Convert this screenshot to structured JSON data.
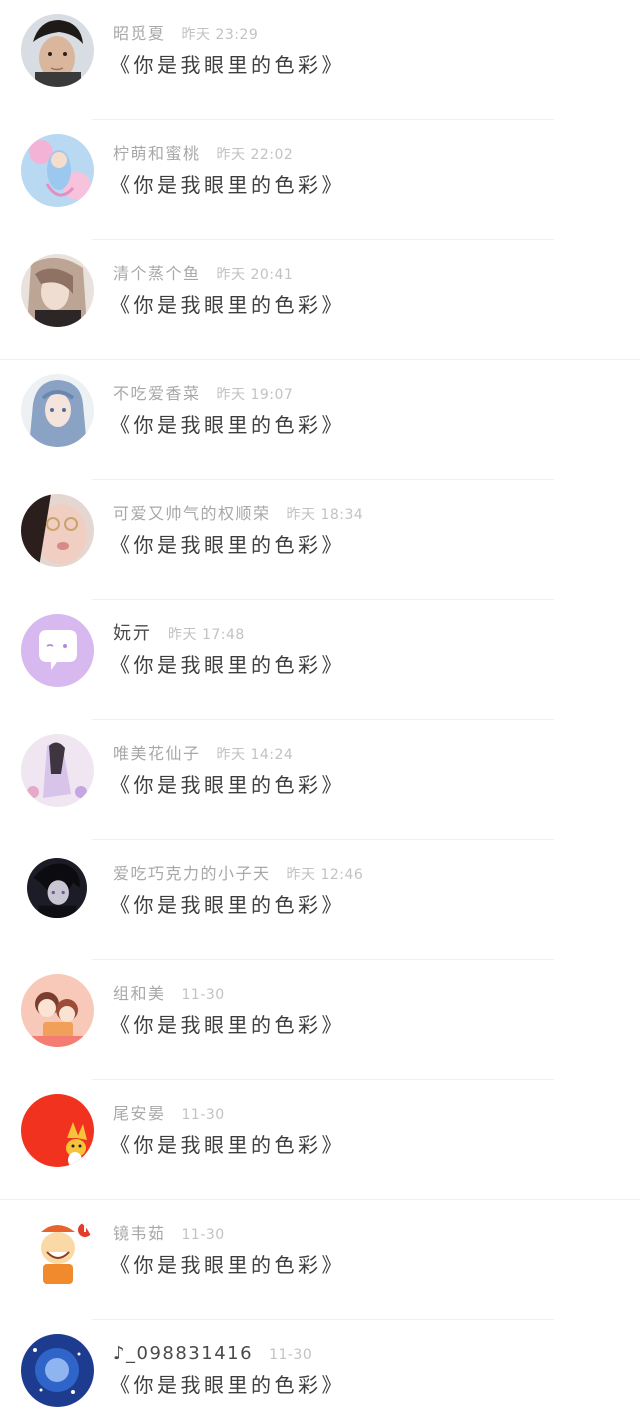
{
  "comments": [
    {
      "name": "昭觅夏",
      "time": "昨天 23:29",
      "message": "《你是我眼里的色彩》",
      "avatar": "man-portrait-avatar"
    },
    {
      "name": "柠萌和蜜桃",
      "time": "昨天 22:02",
      "message": "《你是我眼里的色彩》",
      "avatar": "fairy-anime-avatar"
    },
    {
      "name": "清个蒸个鱼",
      "time": "昨天 20:41",
      "message": "《你是我眼里的色彩》",
      "avatar": "sketch-girl-avatar"
    },
    {
      "name": "不吃爱香菜",
      "time": "昨天 19:07",
      "message": "《你是我眼里的色彩》",
      "avatar": "blue-hair-girl-avatar"
    },
    {
      "name": "可爱又帅气的权顺荣",
      "time": "昨天 18:34",
      "message": "《你是我眼里的色彩》",
      "avatar": "kiss-face-avatar"
    },
    {
      "name": "妧亓",
      "time": "昨天 17:48",
      "message": "《你是我眼里的色彩》",
      "avatar": "chat-bubble-avatar"
    },
    {
      "name": "唯美花仙子",
      "time": "昨天 14:24",
      "message": "《你是我眼里的色彩》",
      "avatar": "flower-fairy-avatar"
    },
    {
      "name": "爱吃巧克力的小子天",
      "time": "昨天 12:46",
      "message": "《你是我眼里的色彩》",
      "avatar": "dark-anime-boy-avatar"
    },
    {
      "name": "组和美",
      "time": "11-30",
      "message": "《你是我眼里的色彩》",
      "avatar": "cartoon-girls-avatar"
    },
    {
      "name": "尾安晏",
      "time": "11-30",
      "message": "《你是我眼里的色彩》",
      "avatar": "red-fox-avatar"
    },
    {
      "name": "镜韦茹",
      "time": "11-30",
      "message": "《你是我眼里的色彩》",
      "avatar": "cartoon-boy-avatar"
    },
    {
      "name": "♪_098831416",
      "time": "11-30",
      "message": "《你是我眼里的色彩》",
      "avatar": "blue-galaxy-avatar"
    }
  ],
  "colors": {
    "name_text": "#a8a8a8",
    "time_text": "#c2c2c2",
    "message_text": "#3e3e3e",
    "divider": "#f0f0f0",
    "chat_avatar_bg": "#d7b8ef",
    "fox_avatar_bg": "#f0321f"
  }
}
